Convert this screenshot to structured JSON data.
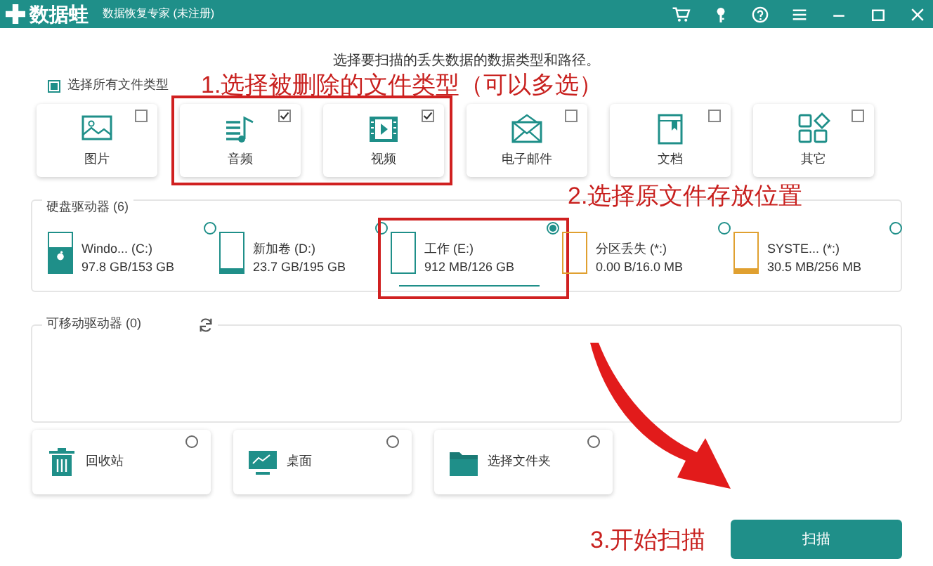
{
  "window": {
    "brand": "数据蛙",
    "title": "数据恢复专家 (未注册)"
  },
  "prompt": "选择要扫描的丢失数据的数据类型和路径。",
  "select_all": {
    "label": "选择所有文件类型",
    "checked": true
  },
  "file_types": [
    {
      "kind": "image",
      "label": "图片",
      "checked": false,
      "highlighted": false
    },
    {
      "kind": "audio",
      "label": "音频",
      "checked": true,
      "highlighted": true
    },
    {
      "kind": "video",
      "label": "视频",
      "checked": true,
      "highlighted": true
    },
    {
      "kind": "email",
      "label": "电子邮件",
      "checked": false,
      "highlighted": false
    },
    {
      "kind": "document",
      "label": "文档",
      "checked": false,
      "highlighted": false
    },
    {
      "kind": "other",
      "label": "其它",
      "checked": false,
      "highlighted": false
    }
  ],
  "hard_drives": {
    "title": "硬盘驱动器 (6)",
    "drives": [
      {
        "kind": "system",
        "name": "Windo... (C:)",
        "size": "97.8 GB/153 GB",
        "level": 0.64,
        "color": "#1f8f89",
        "selected": false,
        "highlighted": false
      },
      {
        "kind": "disk",
        "name": "新加卷 (D:)",
        "size": "23.7 GB/195 GB",
        "level": 0.12,
        "color": "#1f8f89",
        "selected": false,
        "highlighted": false
      },
      {
        "kind": "disk",
        "name": "工作 (E:)",
        "size": "912 MB/126 GB",
        "level": 0,
        "color": "#1f8f89",
        "selected": true,
        "highlighted": true
      },
      {
        "kind": "disk",
        "name": "分区丢失 (*:)",
        "size": "0.00  B/16.0 MB",
        "level": 0,
        "color": "#e0a030",
        "selected": false,
        "highlighted": false
      },
      {
        "kind": "disk",
        "name": "SYSTE... (*:)",
        "size": "30.5 MB/256 MB",
        "level": 0.12,
        "color": "#e0a030",
        "selected": false,
        "highlighted": false
      }
    ]
  },
  "removable_drives": {
    "title": "可移动驱动器 (0)"
  },
  "locations": [
    {
      "kind": "recycle",
      "label": "回收站",
      "selected": false
    },
    {
      "kind": "desktop",
      "label": "桌面",
      "selected": false
    },
    {
      "kind": "folder",
      "label": "选择文件夹",
      "selected": false
    }
  ],
  "scan_button": "扫描",
  "annotations": [
    {
      "kind": "step",
      "text": "1.选择被删除的文件类型（可以多选）"
    },
    {
      "kind": "step",
      "text": "2.选择原文件存放位置"
    },
    {
      "kind": "step",
      "text": "3.开始扫描"
    }
  ]
}
